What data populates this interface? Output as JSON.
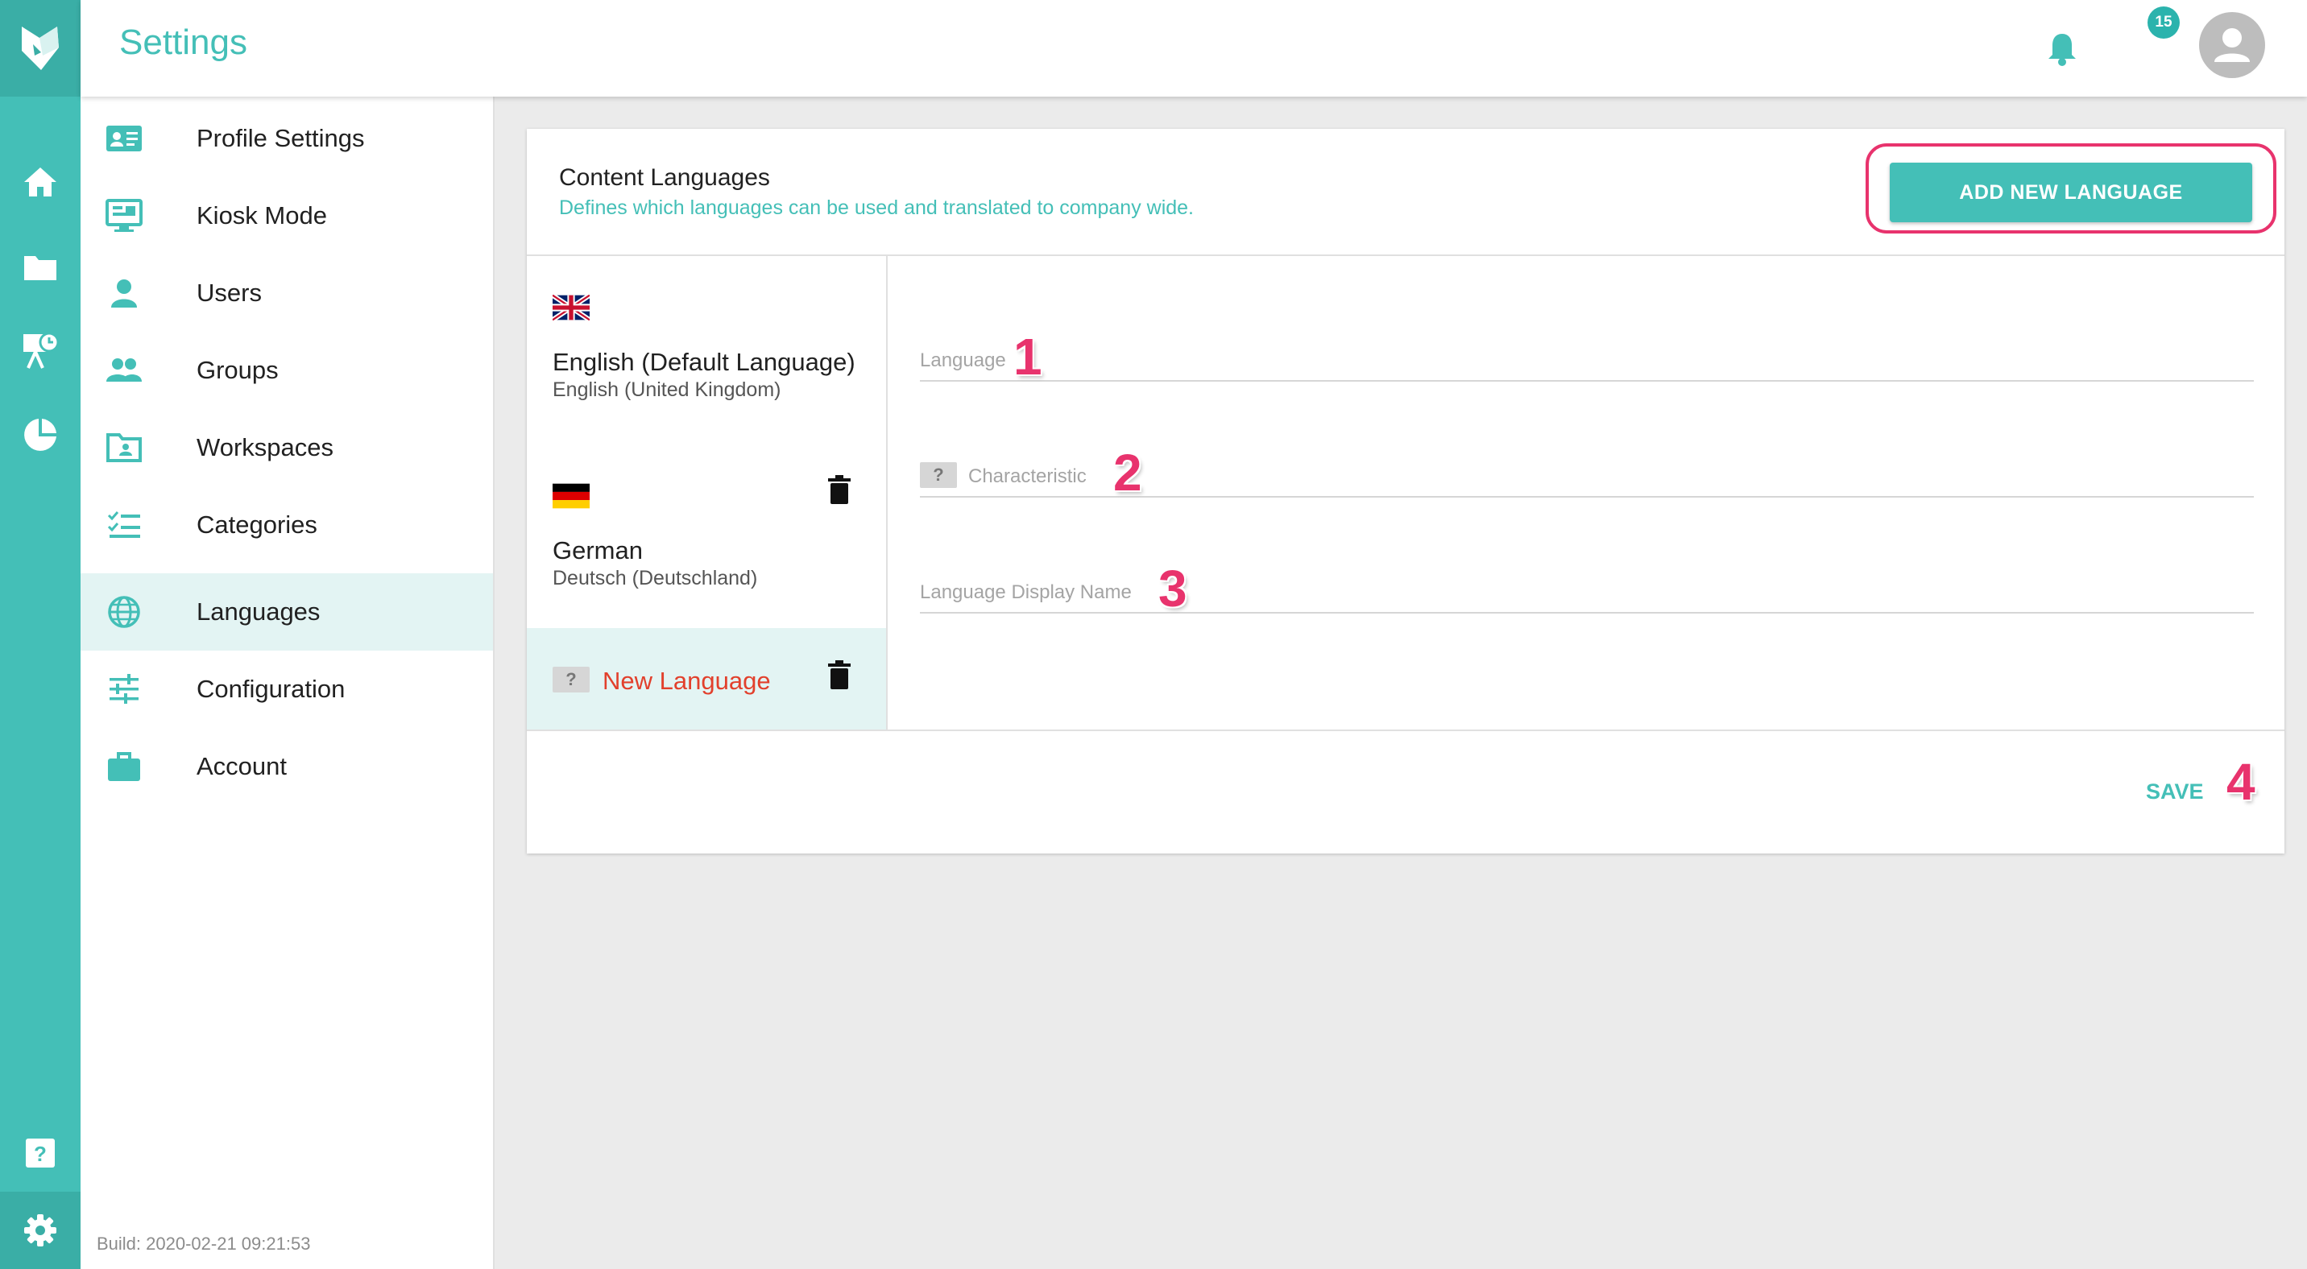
{
  "app": {
    "title": "Settings",
    "notification_count": "15",
    "build": "Build: 2020-02-21 09:21:53",
    "accent": "#44bfb7",
    "highlight": "#e8336d"
  },
  "rail": {
    "icons": [
      "logo-icon",
      "home-icon",
      "folder-icon",
      "presentation-icon",
      "pie-chart-icon",
      "help-icon",
      "gear-icon"
    ]
  },
  "sidebar": {
    "items": [
      {
        "label": "Profile Settings",
        "icon": "profile-card-icon"
      },
      {
        "label": "Kiosk Mode",
        "icon": "monitor-icon"
      },
      {
        "label": "Users",
        "icon": "user-icon"
      },
      {
        "label": "Groups",
        "icon": "group-icon"
      },
      {
        "label": "Workspaces",
        "icon": "workspace-folder-icon"
      },
      {
        "label": "Categories",
        "icon": "checklist-icon"
      },
      {
        "label": "Languages",
        "icon": "globe-icon",
        "active": true
      },
      {
        "label": "Configuration",
        "icon": "sliders-icon"
      },
      {
        "label": "Account",
        "icon": "briefcase-icon"
      }
    ]
  },
  "content_languages": {
    "title": "Content Languages",
    "subtitle": "Defines which languages can be used and translated to company wide.",
    "add_button": "ADD NEW LANGUAGE",
    "languages": [
      {
        "name": "English (Default Language)",
        "native": "English (United Kingdom)",
        "flag": "uk-flag-icon"
      },
      {
        "name": "German",
        "native": "Deutsch (Deutschland)",
        "flag": "germany-flag-icon"
      },
      {
        "name": "New Language",
        "placeholder_flag": "?",
        "flag": "unknown-flag-icon"
      }
    ],
    "form": {
      "language_label": "Language",
      "characteristic_label": "Characteristic",
      "characteristic_flag": "?",
      "display_name_label": "Language Display Name"
    },
    "annotations": [
      "1",
      "2",
      "3",
      "4"
    ],
    "save_button": "SAVE"
  }
}
